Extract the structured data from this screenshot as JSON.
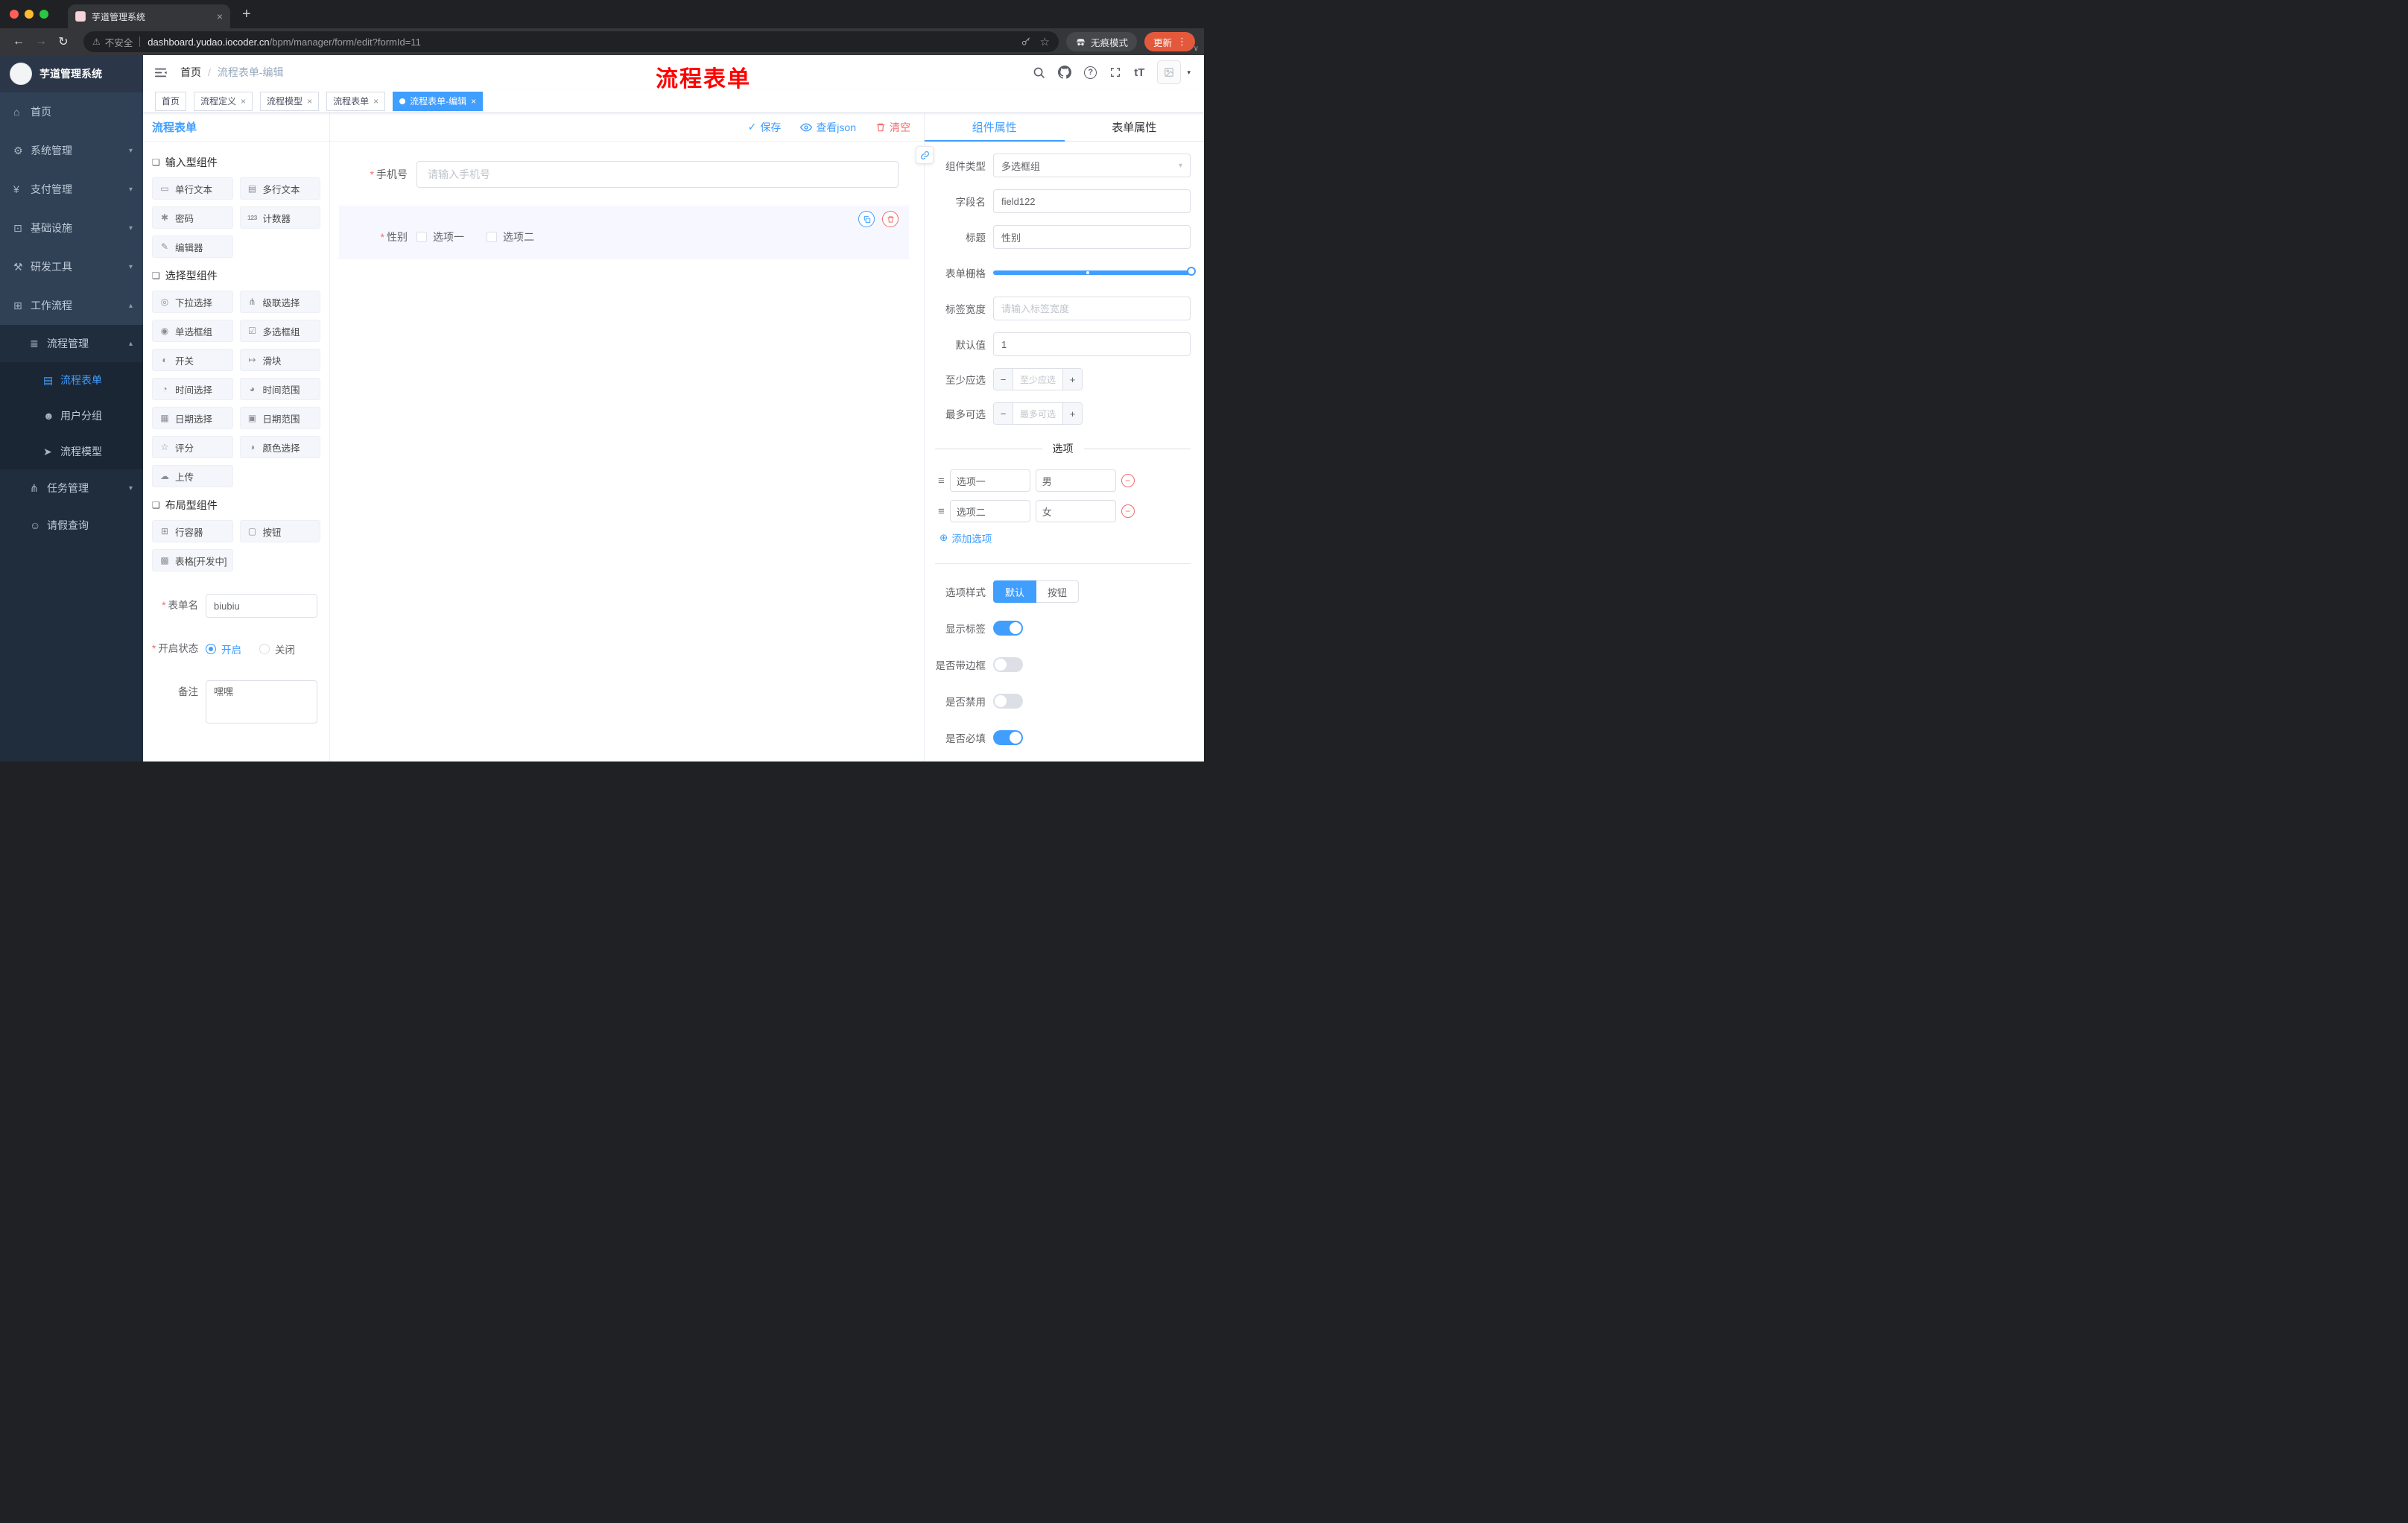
{
  "colors": {
    "primary": "#409eff",
    "danger": "#f56c6c",
    "annotation_red": "#ff0000",
    "sidebar_bg": "#304156",
    "sidebar_submenu_bg": "#1f2d3d",
    "tab_active_bg": "#409eff",
    "update_button_bg": "#e4593b"
  },
  "glyphs": {
    "back": "←",
    "forward": "→",
    "reload": "↻",
    "warning": "⚠",
    "star": "☆",
    "dots": "⋮",
    "chevron": "∨",
    "plus": "+",
    "close": "×",
    "check": "✓",
    "caret_down": "▾",
    "arrow_up": "▴",
    "arrow_down": "▾",
    "drag": "≡",
    "add": "⊕",
    "minus": "−",
    "font_size": "tT",
    "help": "?",
    "tab_dot": "●",
    "slash": "/",
    "home": "⌂",
    "gear": "⚙",
    "yen": "¥",
    "infra": "⊡",
    "tools": "⚒",
    "workflow": "⊞",
    "list": "≣",
    "form": "▤",
    "users": "☻",
    "model": "➤",
    "tasks": "⋔",
    "person": "☺",
    "section": "❏",
    "single_text": "▭",
    "multi_text": "▤",
    "password": "✱",
    "counter": "123",
    "editor": "✎",
    "select": "◎",
    "cascader": "⋔",
    "radio_group": "◉",
    "checkbox_group": "☑",
    "switch": "◐",
    "slider": "↦",
    "time": "◔",
    "time_range": "◕",
    "date": "▦",
    "date_range": "▣",
    "rate": "☆",
    "color": "◑",
    "upload": "☁",
    "row": "⊞",
    "button": "▢",
    "table": "▩"
  },
  "browser": {
    "tab_title": "芋道管理系统",
    "url": {
      "security_label": "不安全",
      "host": "dashboard.yudao.iocoder.cn",
      "path": "/bpm/manager/form/edit?formId=11"
    },
    "incognito_label": "无痕模式",
    "update_label": "更新"
  },
  "sidebar": {
    "logo_title": "芋道管理系统",
    "items": [
      {
        "label": "首页"
      },
      {
        "label": "系统管理"
      },
      {
        "label": "支付管理"
      },
      {
        "label": "基础设施"
      },
      {
        "label": "研发工具"
      },
      {
        "label": "工作流程"
      },
      {
        "label": "流程管理"
      },
      {
        "label": "流程表单"
      },
      {
        "label": "用户分组"
      },
      {
        "label": "流程模型"
      },
      {
        "label": "任务管理"
      },
      {
        "label": "请假查询"
      }
    ]
  },
  "header": {
    "breadcrumb": {
      "home": "首页",
      "current": "流程表单-编辑"
    },
    "overlay_title": "流程表单"
  },
  "tags": [
    {
      "label": "首页"
    },
    {
      "label": "流程定义"
    },
    {
      "label": "流程模型"
    },
    {
      "label": "流程表单"
    },
    {
      "label": "流程表单-编辑"
    }
  ],
  "designer": {
    "panel_title": "流程表单",
    "actions": {
      "save": "保存",
      "view_json": "查看json",
      "clear": "清空"
    },
    "palette": {
      "sections": [
        {
          "title": "输入型组件",
          "items": [
            "单行文本",
            "多行文本",
            "密码",
            "计数器",
            "编辑器"
          ]
        },
        {
          "title": "选择型组件",
          "items": [
            "下拉选择",
            "级联选择",
            "单选框组",
            "多选框组",
            "开关",
            "滑块",
            "时间选择",
            "时间范围",
            "日期选择",
            "日期范围",
            "评分",
            "颜色选择",
            "上传"
          ]
        },
        {
          "title": "布局型组件",
          "items": [
            "行容器",
            "按钮",
            "表格[开发中]"
          ]
        }
      ]
    },
    "meta": {
      "name_label": "表单名",
      "name_value": "biubiu",
      "status_label": "开启状态",
      "status_on": "开启",
      "status_off": "关闭",
      "remark_label": "备注",
      "remark_value": "嘿嘿"
    },
    "canvas": {
      "phone_label": "手机号",
      "phone_placeholder": "请输入手机号",
      "gender_label": "性别",
      "gender_opt1": "选项一",
      "gender_opt2": "选项二"
    }
  },
  "props": {
    "tab_component": "组件属性",
    "tab_form": "表单属性",
    "rows": {
      "component_type_label": "组件类型",
      "component_type_value": "多选框组",
      "field_label": "字段名",
      "field_value": "field122",
      "title_label": "标题",
      "title_value": "性别",
      "grid_label": "表单栅格",
      "label_width_label": "标签宽度",
      "label_width_placeholder": "请输入标签宽度",
      "default_label": "默认值",
      "default_value": "1",
      "min_label": "至少应选",
      "min_placeholder": "至少应选",
      "max_label": "最多可选",
      "max_placeholder": "最多可选"
    },
    "options": {
      "title": "选项",
      "rows": [
        {
          "label": "选项一",
          "value": "男"
        },
        {
          "label": "选项二",
          "value": "女"
        }
      ],
      "add": "添加选项"
    },
    "style": {
      "label": "选项样式",
      "opt_default": "默认",
      "opt_button": "按钮"
    },
    "switches": [
      {
        "label": "显示标签"
      },
      {
        "label": "是否带边框"
      },
      {
        "label": "是否禁用"
      },
      {
        "label": "是否必填"
      }
    ]
  }
}
